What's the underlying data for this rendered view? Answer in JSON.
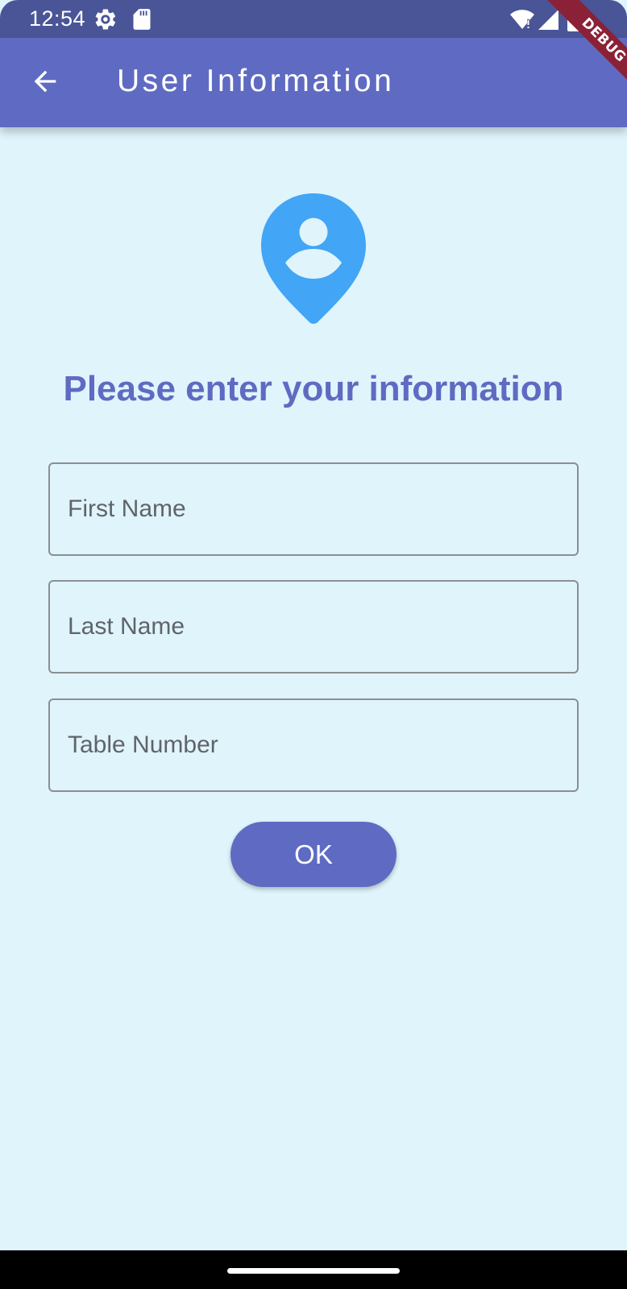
{
  "status_bar": {
    "time": "12:54",
    "icons": [
      "settings-gear-icon",
      "sd-card-icon",
      "wifi-icon",
      "cell-signal-icon",
      "battery-icon"
    ]
  },
  "app_bar": {
    "back_icon": "arrow-back-icon",
    "title": "User Information"
  },
  "debug_banner": {
    "label": "DEBUG"
  },
  "main": {
    "hero_icon": "person-pin-icon",
    "heading": "Please enter your information",
    "fields": {
      "first_name": {
        "placeholder": "First Name",
        "value": ""
      },
      "last_name": {
        "placeholder": "Last Name",
        "value": ""
      },
      "table_number": {
        "placeholder": "Table Number",
        "value": ""
      }
    },
    "ok_label": "OK"
  },
  "colors": {
    "primary": "#5f6bc2",
    "status_bar": "#4a5597",
    "background": "#e0f4fc",
    "hero_icon": "#42a5f5",
    "debug_ribbon": "#8a2137",
    "field_border": "#8a8f93"
  }
}
